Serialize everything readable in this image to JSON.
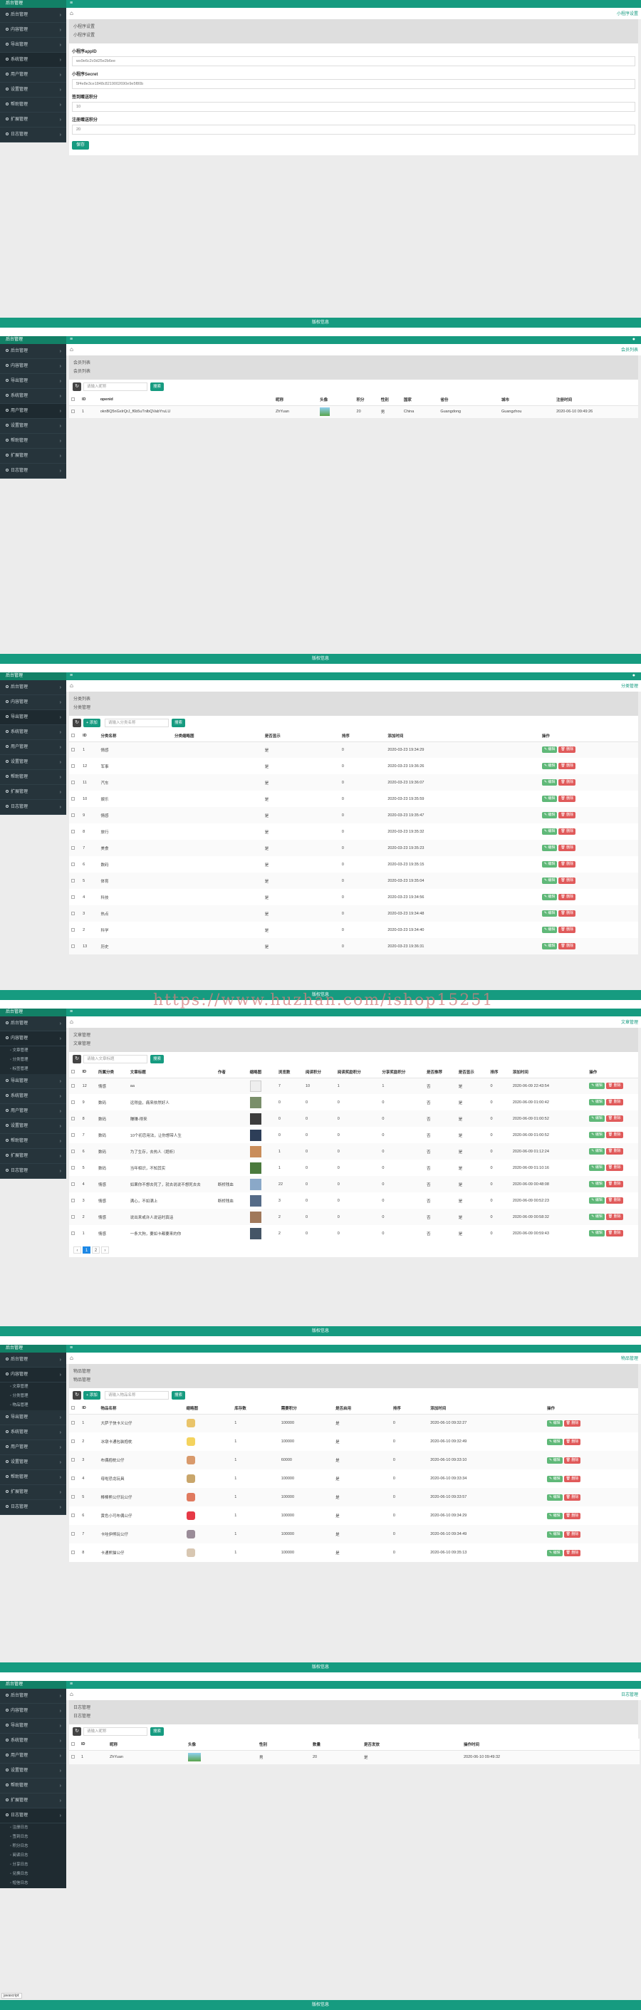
{
  "common": {
    "brand": "后台管理",
    "footer": "版权信息",
    "menu": [
      "后台管理",
      "内容管理",
      "导出管理",
      "系统管理",
      "用户管理",
      "设置管理",
      "帮助管理",
      "扩展管理",
      "日志管理"
    ]
  },
  "s1": {
    "breadcrumb_right": "小程序设置",
    "head": [
      "小程序设置",
      "小程序设置"
    ],
    "fields": [
      {
        "label": "小程序appID",
        "value": "wx9e6c2c0d25e2b6ee"
      },
      {
        "label": "小程序Secret",
        "value": "5f4e8e3ce1848c8219002690e9e5f80b"
      },
      {
        "label": "签到赠送积分",
        "value": "10"
      },
      {
        "label": "注册赠送积分",
        "value": "20"
      }
    ],
    "save": "保存"
  },
  "s2": {
    "breadcrumb_right": "会员列表",
    "head": [
      "会员列表",
      "会员列表"
    ],
    "search_placeholder": "请输入昵称",
    "search_btn": "搜索",
    "columns": [
      "ID",
      "openid",
      "昵称",
      "头像",
      "积分",
      "性别",
      "国家",
      "省份",
      "城市",
      "注册时间"
    ],
    "rows": [
      {
        "id": "1",
        "openid": "oknBQ5nGxlrQrJ_f6b5uTnlbQVabYruLU",
        "nick": "ZhYuan",
        "score": "20",
        "gender": "男",
        "country": "China",
        "province": "Guangdong",
        "city": "Guangzhou",
        "time": "2020-06-10 09:49:26"
      }
    ]
  },
  "s3": {
    "breadcrumb_right": "分类管理",
    "head": [
      "分类列表",
      "分类管理"
    ],
    "add": "添加",
    "search_placeholder": "请输入分类名称",
    "search_btn": "搜索",
    "columns": [
      "ID",
      "分类名称",
      "分类缩略图",
      "是否显示",
      "排序",
      "添加时间",
      "操作"
    ],
    "edit": "编辑",
    "del": "删除",
    "rows": [
      {
        "id": "1",
        "name": "情感",
        "show": "是",
        "sort": "0",
        "time": "2020-03-23 19:34:29"
      },
      {
        "id": "12",
        "name": "军事",
        "show": "是",
        "sort": "0",
        "time": "2020-03-23 19:36:26"
      },
      {
        "id": "11",
        "name": "汽车",
        "show": "是",
        "sort": "0",
        "time": "2020-03-23 19:36:07"
      },
      {
        "id": "10",
        "name": "娱乐",
        "show": "是",
        "sort": "0",
        "time": "2020-03-23 19:35:59"
      },
      {
        "id": "9",
        "name": "情感",
        "show": "是",
        "sort": "0",
        "time": "2020-03-23 19:35:47"
      },
      {
        "id": "8",
        "name": "旅行",
        "show": "是",
        "sort": "0",
        "time": "2020-03-23 19:35:32"
      },
      {
        "id": "7",
        "name": "美食",
        "show": "是",
        "sort": "0",
        "time": "2020-03-23 19:35:23"
      },
      {
        "id": "6",
        "name": "数码",
        "show": "是",
        "sort": "0",
        "time": "2020-03-23 19:35:15"
      },
      {
        "id": "5",
        "name": "体育",
        "show": "是",
        "sort": "0",
        "time": "2020-03-23 19:35:04"
      },
      {
        "id": "4",
        "name": "科技",
        "show": "是",
        "sort": "0",
        "time": "2020-03-23 19:34:56"
      },
      {
        "id": "3",
        "name": "热点",
        "show": "是",
        "sort": "0",
        "time": "2020-03-23 19:34:48"
      },
      {
        "id": "2",
        "name": "科学",
        "show": "是",
        "sort": "0",
        "time": "2020-03-23 19:34:40"
      },
      {
        "id": "13",
        "name": "历史",
        "show": "是",
        "sort": "0",
        "time": "2020-03-23 19:36:31"
      }
    ]
  },
  "s4": {
    "breadcrumb_right": "文章管理",
    "head": [
      "文章管理",
      "文章管理"
    ],
    "submenu": [
      "文章管理",
      "分类管理",
      "标签管理"
    ],
    "search_placeholder": "请输入文章标题",
    "search_btn": "搜索",
    "columns": [
      "ID",
      "所属分类",
      "文章标题",
      "作者",
      "缩略图",
      "浏览数",
      "阅读积分",
      "阅读奖励积分",
      "分享奖励积分",
      "是否推荐",
      "是否显示",
      "排序",
      "添加时间",
      "操作"
    ],
    "edit": "编辑",
    "del": "删除",
    "rows": [
      {
        "id": "12",
        "cat": "情感",
        "title": "aa",
        "author": "",
        "views": "7",
        "read": "10",
        "reward": "1",
        "share": "1",
        "rec": "否",
        "show": "是",
        "sort": "0",
        "time": "2020-06-09 22:43:54"
      },
      {
        "id": "9",
        "cat": "数码",
        "title": "远得益，痛来依然好人",
        "author": "",
        "views": "0",
        "read": "0",
        "reward": "0",
        "share": "0",
        "rec": "否",
        "show": "是",
        "sort": "0",
        "time": "2020-06-09 01:00:42"
      },
      {
        "id": "8",
        "cat": "数码",
        "title": "赚赚-得来",
        "author": "",
        "views": "0",
        "read": "0",
        "reward": "0",
        "share": "0",
        "rec": "否",
        "show": "是",
        "sort": "0",
        "time": "2020-06-09 01:00:52"
      },
      {
        "id": "7",
        "cat": "数码",
        "title": "10个初恋用法，让你想带人生",
        "author": "",
        "views": "0",
        "read": "0",
        "reward": "0",
        "share": "0",
        "rec": "否",
        "show": "是",
        "sort": "0",
        "time": "2020-06-09 01:00:52"
      },
      {
        "id": "6",
        "cat": "数码",
        "title": "为了生存，去热人（题析）",
        "author": "",
        "views": "1",
        "read": "0",
        "reward": "0",
        "share": "0",
        "rec": "否",
        "show": "是",
        "sort": "0",
        "time": "2020-06-09 01:12:24"
      },
      {
        "id": "5",
        "cat": "数码",
        "title": "当年相识，不知其实",
        "author": "",
        "views": "1",
        "read": "0",
        "reward": "0",
        "share": "0",
        "rec": "否",
        "show": "是",
        "sort": "0",
        "time": "2020-06-09 01:10:16"
      },
      {
        "id": "4",
        "cat": "情感",
        "title": "如果你不想去死了，就去说说不想死去去",
        "author": "断桥残血",
        "views": "22",
        "read": "0",
        "reward": "0",
        "share": "0",
        "rec": "否",
        "show": "是",
        "sort": "0",
        "time": "2020-06-09 00:48:08"
      },
      {
        "id": "3",
        "cat": "情感",
        "title": "满心，不如满上",
        "author": "断桥残血",
        "views": "3",
        "read": "0",
        "reward": "0",
        "share": "0",
        "rec": "否",
        "show": "是",
        "sort": "0",
        "time": "2020-06-09 00:52:23"
      },
      {
        "id": "2",
        "cat": "情感",
        "title": "说出来或许人说话时真话",
        "author": "",
        "views": "2",
        "read": "0",
        "reward": "0",
        "share": "0",
        "rec": "否",
        "show": "是",
        "sort": "0",
        "time": "2020-06-09 00:58:32"
      },
      {
        "id": "1",
        "cat": "情感",
        "title": "一条大狗，要如卡都要来的你",
        "author": "",
        "views": "2",
        "read": "0",
        "reward": "0",
        "share": "0",
        "rec": "否",
        "show": "是",
        "sort": "0",
        "time": "2020-06-09 00:59:43"
      }
    ],
    "pager": [
      "‹",
      "1",
      "2",
      "›"
    ]
  },
  "s5": {
    "breadcrumb_right": "物品管理",
    "head": [
      "物品管理",
      "物品管理"
    ],
    "submenu": [
      "文章管理",
      "分类管理",
      "物品管理"
    ],
    "add": "添加",
    "search_placeholder": "请输入物品名称",
    "search_btn": "搜索",
    "columns": [
      "ID",
      "物品名称",
      "缩略图",
      "库存数",
      "需要积分",
      "是否启用",
      "排序",
      "添加时间",
      "操作"
    ],
    "edit": "编辑",
    "del": "删除",
    "rows": [
      {
        "id": "1",
        "name": "大萨子快卡义公仔",
        "stock": "1",
        "score": "100000",
        "on": "是",
        "sort": "0",
        "time": "2020-06-10 09:32:27"
      },
      {
        "id": "2",
        "name": "冰墩卡通包装抱枕",
        "stock": "1",
        "score": "100000",
        "on": "是",
        "sort": "0",
        "time": "2020-06-10 09:32:49"
      },
      {
        "id": "3",
        "name": "布偶抱枕公仔",
        "stock": "1",
        "score": "60000",
        "on": "是",
        "sort": "0",
        "time": "2020-06-10 09:33:10"
      },
      {
        "id": "4",
        "name": "母啦恐龙玩具",
        "stock": "1",
        "score": "100000",
        "on": "是",
        "sort": "0",
        "time": "2020-06-10 09:33:34"
      },
      {
        "id": "5",
        "name": "棒棒熊公仔玩公仔",
        "stock": "1",
        "score": "100000",
        "on": "是",
        "sort": "0",
        "time": "2020-06-10 09:33:57"
      },
      {
        "id": "6",
        "name": "黄色小可布偶公仔",
        "stock": "1",
        "score": "100000",
        "on": "是",
        "sort": "0",
        "time": "2020-06-10 09:34:29"
      },
      {
        "id": "7",
        "name": "卡哇伊熊玩公仔",
        "stock": "1",
        "score": "100000",
        "on": "是",
        "sort": "0",
        "time": "2020-06-10 09:34:49"
      },
      {
        "id": "8",
        "name": "卡通熊猫公仔",
        "stock": "1",
        "score": "100000",
        "on": "是",
        "sort": "0",
        "time": "2020-06-10 09:35:13"
      }
    ]
  },
  "s6": {
    "breadcrumb_right": "日志管理",
    "head": [
      "日志管理",
      "日志管理"
    ],
    "submenu": [
      "注册日志",
      "签到日志",
      "积分日志",
      "阅读日志",
      "分享日志",
      "兑换日志",
      "短信日志"
    ],
    "search_placeholder": "请输入昵称",
    "search_btn": "搜索",
    "columns": [
      "ID",
      "昵称",
      "头像",
      "性别",
      "数量",
      "是否发放",
      "操作时间"
    ],
    "rows": [
      {
        "id": "1",
        "nick": "ZhYuan",
        "gender": "男",
        "num": "20",
        "sent": "是",
        "time": "2020-06-10 09:49:32"
      }
    ],
    "bottom_tip": "javascript:"
  },
  "watermark": "https://www.huzhan.com/ishop15251",
  "colors": {
    "accent": "#169b80",
    "sidebar": "#26343b",
    "edit": "#5fb878",
    "del": "#e05a5a"
  }
}
